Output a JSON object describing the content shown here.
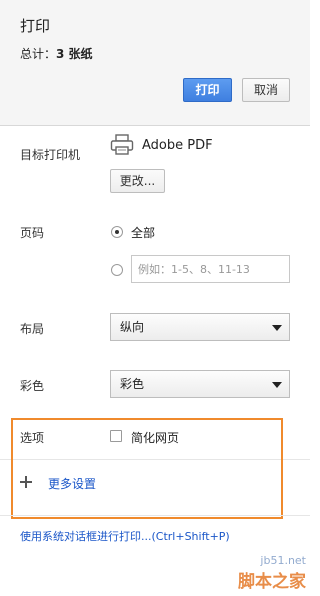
{
  "header": {
    "title": "打印",
    "total_prefix": "总计：",
    "total_value": "3 张纸",
    "print_button": "打印",
    "cancel_button": "取消"
  },
  "destination": {
    "label": "目标打印机",
    "printer_icon": "printer-icon",
    "printer_name": "Adobe PDF",
    "change_button": "更改..."
  },
  "pages": {
    "label": "页码",
    "all_label": "全部",
    "custom_placeholder": "例如：1-5、8、11-13"
  },
  "layout": {
    "label": "布局",
    "value": "纵向"
  },
  "color": {
    "label": "彩色",
    "value": "彩色"
  },
  "options": {
    "label": "选项",
    "simplify_label": "简化网页"
  },
  "more_settings": {
    "icon": "plus-icon",
    "label": "更多设置"
  },
  "system_dialog": "使用系统对话框进行打印...(Ctrl+Shift+P)",
  "watermark": {
    "url": "jb51.net",
    "name": "脚本之家"
  },
  "colors": {
    "primary_button": "#4a8be8",
    "link": "#1a56c8",
    "highlight_border": "#f08a2c"
  }
}
